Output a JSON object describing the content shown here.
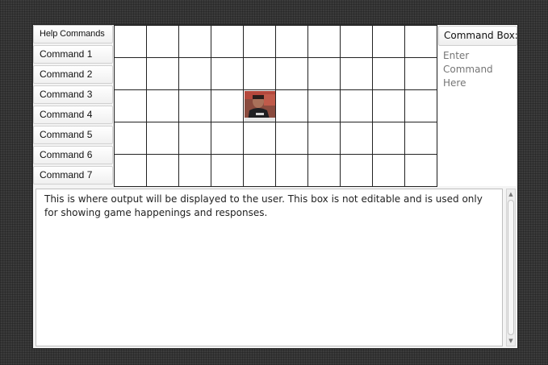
{
  "left_panel": {
    "help_label": "Help Commands",
    "commands": [
      "Command 1",
      "Command 2",
      "Command 3",
      "Command 4",
      "Command 5",
      "Command 6",
      "Command 7"
    ]
  },
  "grid": {
    "rows": 5,
    "cols": 10,
    "player": {
      "row": 2,
      "col": 4,
      "icon": "player-avatar-icon"
    }
  },
  "right_panel": {
    "label": "Command Box:",
    "input_placeholder": "Enter Command Here"
  },
  "output": {
    "text": "This is where output will be displayed to the user. This box is not editable and is used only for showing game happenings and responses."
  }
}
